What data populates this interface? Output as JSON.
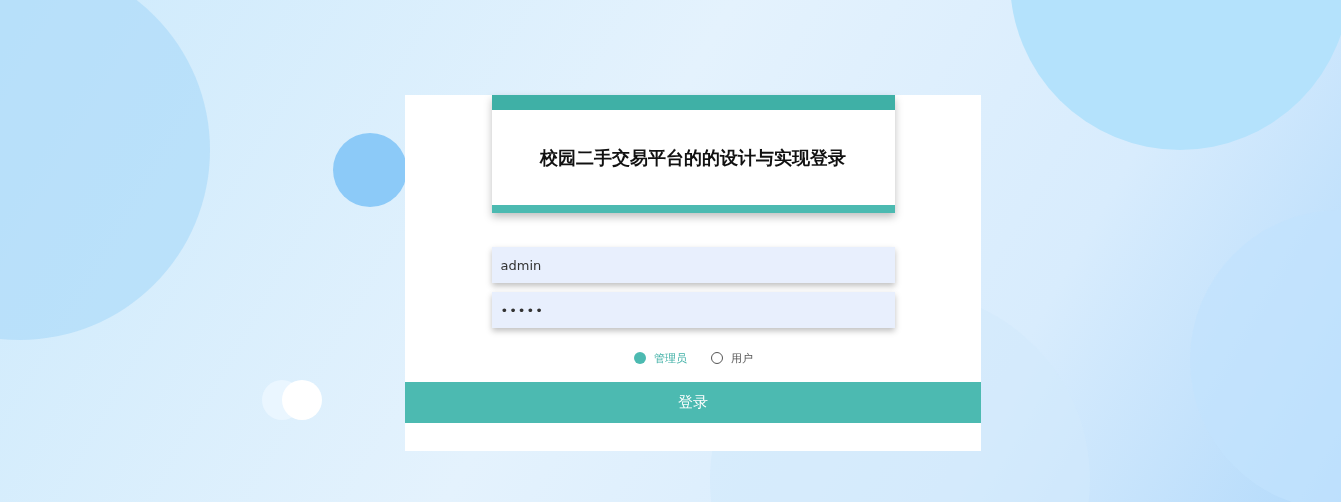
{
  "login": {
    "title": "校园二手交易平台的的设计与实现登录",
    "fields": [
      {
        "kind": "text",
        "value": "admin"
      },
      {
        "kind": "password",
        "value": "•••••"
      }
    ],
    "roles": [
      {
        "label": "管理员",
        "selected": true
      },
      {
        "label": "用户",
        "selected": false
      }
    ],
    "submit": "登录"
  }
}
